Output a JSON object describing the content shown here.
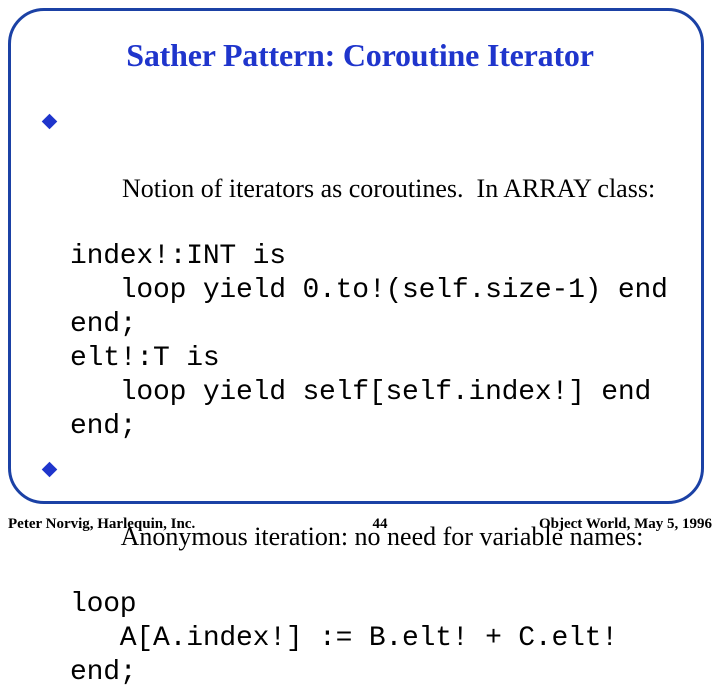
{
  "slide": {
    "title": "Sather Pattern: Coroutine Iterator",
    "frame_color": "#1b41a5",
    "title_color": "#1f35cc",
    "bullet_color": "#1f35cc",
    "bullet_icon": "diamond-bullet-icon"
  },
  "body": {
    "blocks": [
      {
        "bullet": "Notion of iterators as coroutines.  In ARRAY class:",
        "code": [
          "index!:INT is",
          "   loop yield 0.to!(self.size-1) end",
          "end;",
          "elt!:T is",
          "   loop yield self[self.index!] end",
          "end;"
        ]
      },
      {
        "bullet": "Anonymous iteration: no need for variable names:",
        "code": [
          "loop",
          "   A[A.index!] := B.elt! + C.elt!",
          "end;"
        ]
      }
    ]
  },
  "footer": {
    "left": "Peter Norvig, Harlequin, Inc.",
    "page": "44",
    "right": "Object World, May 5, 1996"
  }
}
